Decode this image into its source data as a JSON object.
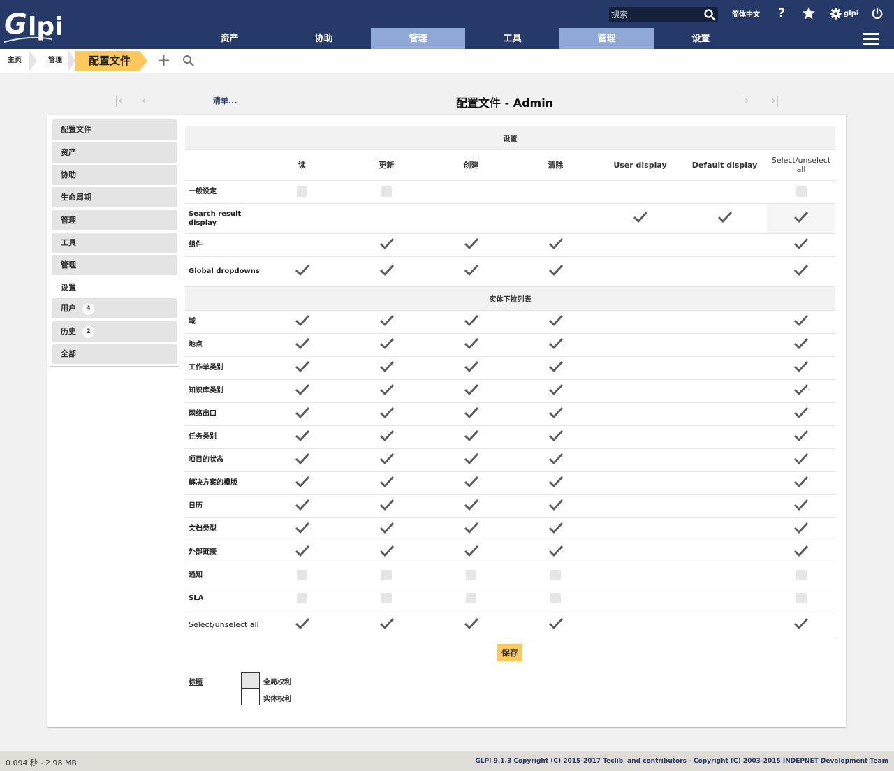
{
  "header": {
    "search_placeholder": "搜索",
    "language": "简体中文",
    "user": "glpi",
    "colors": {
      "header_bg": "#253a68",
      "active_menu": "#8fa8d6",
      "accent": "#fec95c"
    }
  },
  "menu": [
    "资产",
    "协助",
    "管理",
    "工具",
    "管理",
    "设置"
  ],
  "breadcrumb": {
    "home": "主页",
    "admin": "管理",
    "current": "配置文件"
  },
  "nav": {
    "list": "清单...",
    "title": "配置文件 - Admin"
  },
  "tabs": [
    {
      "label": "配置文件"
    },
    {
      "label": "资产"
    },
    {
      "label": "协助"
    },
    {
      "label": "生命周期"
    },
    {
      "label": "管理"
    },
    {
      "label": "工具"
    },
    {
      "label": "管理"
    },
    {
      "label": "设置"
    },
    {
      "label": "用户",
      "badge": "4"
    },
    {
      "label": "历史",
      "badge": "2"
    },
    {
      "label": "全部"
    }
  ],
  "table": {
    "section1": "设置",
    "columns": [
      "读",
      "更新",
      "创建",
      "清除",
      "User display",
      "Default display",
      "Select/unselect all"
    ],
    "section2": "实体下拉列表",
    "rows1": [
      {
        "label": "一般设定",
        "cells": [
          "box",
          "box",
          "",
          "",
          "",
          "",
          "box"
        ]
      },
      {
        "label": "Search result display",
        "cells": [
          "",
          "",
          "",
          "",
          "check",
          "check",
          "check"
        ]
      },
      {
        "label": "组件",
        "cells": [
          "",
          "check",
          "check",
          "check",
          "",
          "",
          "check"
        ]
      },
      {
        "label": "Global dropdowns",
        "cells": [
          "check",
          "check",
          "check",
          "check",
          "",
          "",
          "check"
        ]
      }
    ],
    "rows2": [
      {
        "label": "域",
        "cells": [
          "check",
          "check",
          "check",
          "check",
          "",
          "",
          "check"
        ]
      },
      {
        "label": "地点",
        "cells": [
          "check",
          "check",
          "check",
          "check",
          "",
          "",
          "check"
        ]
      },
      {
        "label": "工作单类别",
        "cells": [
          "check",
          "check",
          "check",
          "check",
          "",
          "",
          "check"
        ]
      },
      {
        "label": "知识库类别",
        "cells": [
          "check",
          "check",
          "check",
          "check",
          "",
          "",
          "check"
        ]
      },
      {
        "label": "网络出口",
        "cells": [
          "check",
          "check",
          "check",
          "check",
          "",
          "",
          "check"
        ]
      },
      {
        "label": "任务类别",
        "cells": [
          "check",
          "check",
          "check",
          "check",
          "",
          "",
          "check"
        ]
      },
      {
        "label": "项目的状态",
        "cells": [
          "check",
          "check",
          "check",
          "check",
          "",
          "",
          "check"
        ]
      },
      {
        "label": "解决方案的模版",
        "cells": [
          "check",
          "check",
          "check",
          "check",
          "",
          "",
          "check"
        ]
      },
      {
        "label": "日历",
        "cells": [
          "check",
          "check",
          "check",
          "check",
          "",
          "",
          "check"
        ]
      },
      {
        "label": "文档类型",
        "cells": [
          "check",
          "check",
          "check",
          "check",
          "",
          "",
          "check"
        ]
      },
      {
        "label": "外部链接",
        "cells": [
          "check",
          "check",
          "check",
          "check",
          "",
          "",
          "check"
        ]
      },
      {
        "label": "通知",
        "cells": [
          "box",
          "box",
          "box",
          "box",
          "",
          "",
          "box"
        ]
      },
      {
        "label": "SLA",
        "cells": [
          "box",
          "box",
          "box",
          "box",
          "",
          "",
          "box"
        ]
      }
    ],
    "select_all_row": {
      "label": "Select/unselect all",
      "cells": [
        "check",
        "check",
        "check",
        "check",
        "",
        "",
        "check"
      ]
    }
  },
  "save": "保存",
  "legend": {
    "title": "标题",
    "global": "全局权利",
    "entity": "实体权利"
  },
  "footer": {
    "time": "0.094 秒 - 2.98 MB",
    "copyright": "GLPI 9.1.3 Copyright (C) 2015-2017 Teclib' and contributors - Copyright (C) 2003-2015 INDEPNET Development Team"
  }
}
